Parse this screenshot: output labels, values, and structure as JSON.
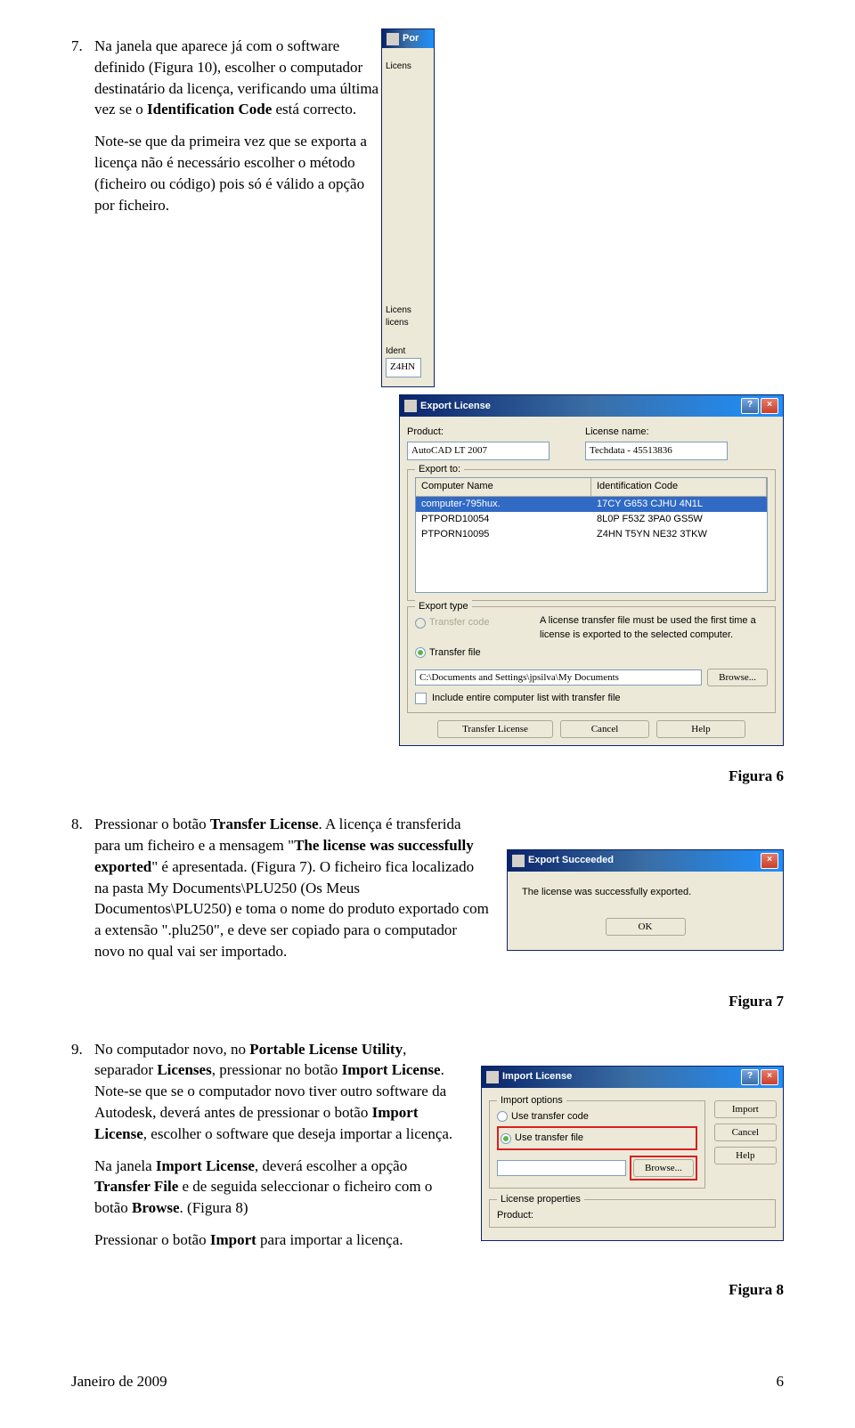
{
  "section7": {
    "num": "7.",
    "text_before_fig10": "Na janela que aparece já com o software definido (Figura 10), escolher o computador destinatário da licença, verificando uma última vez se o ",
    "bold_id_code": "Identification Code",
    "text_after_id_code": " está correcto.",
    "para2": "Note-se que da primeira vez que se exporta a licença não é necessário escolher o método (ficheiro ou código) pois só é válido a opção por ficheiro."
  },
  "export_dialog": {
    "back_title": "Por",
    "title": "Export License",
    "product_label": "Product:",
    "product_value": "AutoCAD LT 2007",
    "license_name_label": "License name:",
    "license_name_value": "Techdata - 45513836",
    "export_to_label": "Export to:",
    "col_computer": "Computer Name",
    "col_id": "Identification Code",
    "rows": [
      {
        "computer": "computer-795hux.",
        "id": "17CY G653 CJHU 4N1L"
      },
      {
        "computer": "PTPORD10054",
        "id": "8L0P F53Z 3PA0 GS5W"
      },
      {
        "computer": "PTPORN10095",
        "id": "Z4HN T5YN NE32 3TKW"
      }
    ],
    "export_type_label": "Export type",
    "transfer_code": "Transfer code",
    "transfer_file": "Transfer file",
    "note": "A license transfer file must be used the first time a license is exported to the selected computer.",
    "path_value": "C:\\Documents and Settings\\jpsilva\\My Documents",
    "browse": "Browse...",
    "include_label": "Include entire computer list with transfer file",
    "btn_transfer": "Transfer License",
    "btn_cancel": "Cancel",
    "btn_help": "Help",
    "back_labels": {
      "licens": "Licens",
      "licens2": "licens",
      "ident": "Ident",
      "z4hn": "Z4HN"
    }
  },
  "figure6": "Figura 6",
  "section8": {
    "num": "8.",
    "text1": "Pressionar o botão ",
    "bold1": "Transfer License",
    "text2": ". A licença é transferida para um ficheiro e a mensagem \"",
    "bold2": "The license was successfully exported",
    "text3": "\" é apresentada. (Figura 7). O ficheiro fica localizado na pasta My Documents\\PLU250 (Os Meus Documentos\\PLU250) e toma o nome do produto exportado com a extensão \".plu250\", e deve ser copiado para o computador novo no qual vai ser importado."
  },
  "succeed_dialog": {
    "title": "Export Succeeded",
    "msg": "The license was successfully exported.",
    "ok": "OK"
  },
  "figure7": "Figura 7",
  "section9": {
    "num": "9.",
    "text1": "No computador novo, no ",
    "bold1": "Portable License Utility",
    "text2": ", separador ",
    "bold2": "Licenses",
    "text3": ", pressionar no botão ",
    "bold3": "Import License",
    "text4": ". Note-se que se o computador novo tiver outro software da Autodesk, deverá antes de pressionar o botão ",
    "bold4": "Import License",
    "text5": ", escolher o software que deseja importar a licença.",
    "text6": "Na janela ",
    "bold5": "Import License",
    "text7": ", deverá escolher a opção ",
    "bold6": "Transfer File",
    "text8": " e de seguida seleccionar o ficheiro com o botão ",
    "bold7": "Browse",
    "text9": ". (Figura 8)",
    "text10": "Pressionar o botão ",
    "bold8": "Import",
    "text11": " para importar a licença."
  },
  "import_dialog": {
    "title": "Import License",
    "import_options": "Import options",
    "use_transfer_code": "Use transfer code",
    "use_transfer_file": "Use transfer file",
    "browse": "Browse...",
    "import": "Import",
    "cancel": "Cancel",
    "help": "Help",
    "license_properties": "License properties",
    "product_label": "Product:"
  },
  "figure8": "Figura 8",
  "footer": {
    "left": "Janeiro de 2009",
    "right": "6"
  }
}
